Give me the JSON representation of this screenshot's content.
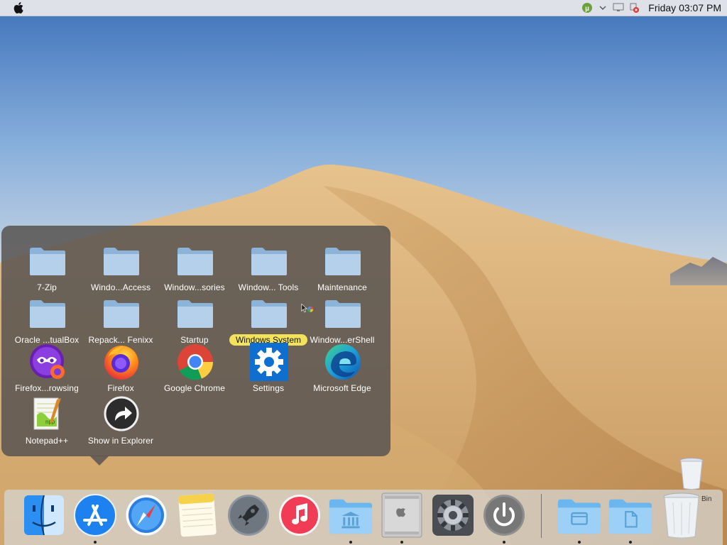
{
  "menubar": {
    "apple_icon": "apple-logo-icon",
    "tray_icons": [
      "utorrent-icon",
      "chevron-down-icon",
      "display-icon",
      "network-error-icon"
    ],
    "clock": "Friday 03:07 PM"
  },
  "popover": {
    "items": [
      {
        "label": "7-Zip",
        "icon": "folder-icon"
      },
      {
        "label": "Windo...Access",
        "icon": "folder-icon"
      },
      {
        "label": "Window...sories",
        "icon": "folder-icon"
      },
      {
        "label": "Window... Tools",
        "icon": "folder-icon"
      },
      {
        "label": "Maintenance",
        "icon": "folder-icon"
      },
      {
        "label": "Oracle ...tualBox",
        "icon": "folder-icon"
      },
      {
        "label": "Repack... Fenixx",
        "icon": "folder-icon"
      },
      {
        "label": "Startup",
        "icon": "folder-icon"
      },
      {
        "label": "Windows System",
        "icon": "folder-icon",
        "highlighted": true
      },
      {
        "label": "Window...erShell",
        "icon": "folder-icon"
      },
      {
        "label": "Firefox...rowsing",
        "icon": "firefox-private-icon"
      },
      {
        "label": "Firefox",
        "icon": "firefox-icon"
      },
      {
        "label": "Google Chrome",
        "icon": "chrome-icon"
      },
      {
        "label": "Settings",
        "icon": "settings-gear-icon"
      },
      {
        "label": "Microsoft Edge",
        "icon": "edge-icon"
      },
      {
        "label": "Notepad++",
        "icon": "notepadpp-icon"
      },
      {
        "label": "Show in Explorer",
        "icon": "show-in-explorer-icon"
      }
    ]
  },
  "dock": {
    "items": [
      {
        "name": "finder",
        "icon": "finder-icon",
        "running": false
      },
      {
        "name": "app-store",
        "icon": "app-store-icon",
        "running": true
      },
      {
        "name": "safari",
        "icon": "safari-icon",
        "running": false
      },
      {
        "name": "notes",
        "icon": "notes-icon",
        "running": false
      },
      {
        "name": "launchpad",
        "icon": "launchpad-rocket-icon",
        "running": false
      },
      {
        "name": "music",
        "icon": "music-icon",
        "running": false
      },
      {
        "name": "library-folder",
        "icon": "library-folder-icon",
        "running": true
      },
      {
        "name": "mac-pro",
        "icon": "mac-pro-icon",
        "running": true
      },
      {
        "name": "system-preferences",
        "icon": "system-preferences-icon",
        "running": false
      },
      {
        "name": "power",
        "icon": "power-icon",
        "running": true
      },
      {
        "name": "applications-folder",
        "icon": "applications-folder-icon",
        "running": true
      },
      {
        "name": "documents-folder",
        "icon": "documents-folder-icon",
        "running": true
      },
      {
        "name": "trash",
        "icon": "trash-icon",
        "running": false
      }
    ]
  },
  "desktop": {
    "trash_label": "Bin"
  },
  "colors": {
    "popover_bg": "#585450",
    "highlight": "#f2e35a",
    "folder_blue": "#a9c6e2"
  }
}
